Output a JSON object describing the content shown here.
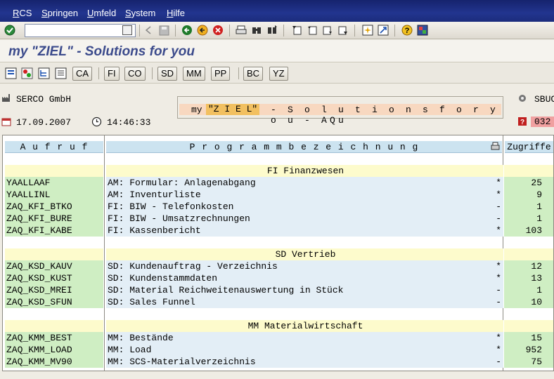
{
  "menu": {
    "items": [
      {
        "u": "R",
        "rest": "CS"
      },
      {
        "u": "S",
        "rest": "pringen"
      },
      {
        "u": "U",
        "rest": "mfeld"
      },
      {
        "u": "S",
        "rest": "ystem"
      },
      {
        "u": "H",
        "rest": "ilfe"
      }
    ]
  },
  "toolbar": {
    "command_value": ""
  },
  "title": "my \"ZIEL\" - Solutions for you",
  "app_buttons": [
    "CA",
    "FI",
    "CO",
    "SD",
    "MM",
    "PP",
    "BC",
    "YZ"
  ],
  "info": {
    "company": "SERCO GmbH",
    "date": "17.09.2007",
    "time": "14:46:33",
    "system": "SBUC",
    "client": "032"
  },
  "banner": {
    "pre": "my",
    "ziel": "\"Z I E L\"",
    "post": "- S o l u t i o n s  f o r  y o u - AQu"
  },
  "table": {
    "headers": [
      "A u f r u f",
      "P r o g r a m m b e z e i c h n u n g",
      "Zugriffe"
    ],
    "sections": [
      {
        "title": "FI Finanzwesen",
        "rows": [
          {
            "code": "YAALLAAF",
            "desc": "AM: Formular: Anlagenabgang",
            "flag": "*",
            "count": "25"
          },
          {
            "code": "YAALLINL",
            "desc": "AM: Inventurliste",
            "flag": "*",
            "count": "9"
          },
          {
            "code": "ZAQ_KFI_BTKO",
            "desc": "FI: BIW - Telefonkosten",
            "flag": "-",
            "count": "1"
          },
          {
            "code": "ZAQ_KFI_BURE",
            "desc": "FI: BIW - Umsatzrechnungen",
            "flag": "-",
            "count": "1"
          },
          {
            "code": "ZAQ_KFI_KABE",
            "desc": "FI: Kassenbericht",
            "flag": "*",
            "count": "103"
          }
        ]
      },
      {
        "title": "SD Vertrieb",
        "rows": [
          {
            "code": "ZAQ_KSD_KAUV",
            "desc": "SD: Kundenauftrag - Verzeichnis",
            "flag": "*",
            "count": "12"
          },
          {
            "code": "ZAQ_KSD_KUST",
            "desc": "SD: Kundenstammdaten",
            "flag": "*",
            "count": "13"
          },
          {
            "code": "ZAQ_KSD_MREI",
            "desc": "SD: Material Reichweitenauswertung in Stück",
            "flag": "-",
            "count": "1"
          },
          {
            "code": "ZAQ_KSD_SFUN",
            "desc": "SD: Sales Funnel",
            "flag": "-",
            "count": "10"
          }
        ]
      },
      {
        "title": "MM Materialwirtschaft",
        "rows": [
          {
            "code": "ZAQ_KMM_BEST",
            "desc": "MM: Bestände",
            "flag": "*",
            "count": "15"
          },
          {
            "code": "ZAQ_KMM_LOAD",
            "desc": "MM: Load",
            "flag": "*",
            "count": "952"
          },
          {
            "code": "ZAQ_KMM_MV90",
            "desc": "MM: SCS-Materialverzeichnis",
            "flag": "-",
            "count": "75"
          }
        ]
      }
    ]
  }
}
